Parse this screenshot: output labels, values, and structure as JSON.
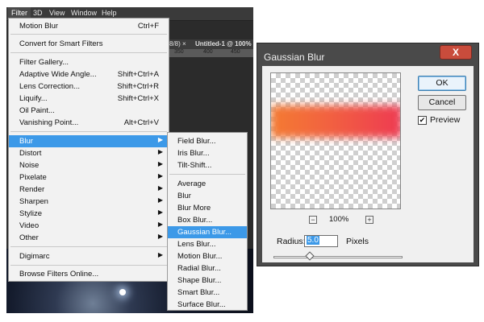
{
  "menubar": {
    "filter": "Filter",
    "3d": "3D",
    "view": "View",
    "window": "Window",
    "help": "Help"
  },
  "doc_tabs": {
    "left": "8/8) ×",
    "active": "Untitled-1 @ 100%"
  },
  "ruler": {
    "t1": "350",
    "t2": "400",
    "t3": "450"
  },
  "filter_menu": {
    "motion_blur": {
      "label": "Motion Blur",
      "shortcut": "Ctrl+F"
    },
    "convert": "Convert for Smart Filters",
    "filter_gallery": "Filter Gallery...",
    "adaptive": {
      "label": "Adaptive Wide Angle...",
      "shortcut": "Shift+Ctrl+A"
    },
    "lens": {
      "label": "Lens Correction...",
      "shortcut": "Shift+Ctrl+R"
    },
    "liquify": {
      "label": "Liquify...",
      "shortcut": "Shift+Ctrl+X"
    },
    "oil": "Oil Paint...",
    "vanishing": {
      "label": "Vanishing Point...",
      "shortcut": "Alt+Ctrl+V"
    },
    "submenus": [
      "Blur",
      "Distort",
      "Noise",
      "Pixelate",
      "Render",
      "Sharpen",
      "Stylize",
      "Video",
      "Other"
    ],
    "digimarc": "Digimarc",
    "browse": "Browse Filters Online..."
  },
  "blur_menu": {
    "group1": [
      "Field Blur...",
      "Iris Blur...",
      "Tilt-Shift..."
    ],
    "group2": [
      "Average",
      "Blur",
      "Blur More",
      "Box Blur...",
      "Gaussian Blur...",
      "Lens Blur...",
      "Motion Blur...",
      "Radial Blur...",
      "Shape Blur...",
      "Smart Blur...",
      "Surface Blur..."
    ]
  },
  "dialog": {
    "title": "Gaussian Blur",
    "close": "X",
    "ok": "OK",
    "cancel": "Cancel",
    "preview_label": "Preview",
    "preview_checked": true,
    "zoom": "100%",
    "zoom_minus": "−",
    "zoom_plus": "+",
    "radius_label": "Radius:",
    "radius_value": "5.0",
    "radius_unit": "Pixels",
    "slider_level": 0.28
  }
}
